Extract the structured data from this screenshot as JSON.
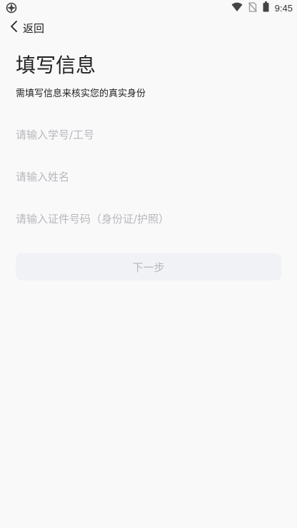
{
  "status_bar": {
    "time": "9:45",
    "left_icon": "app-notification-icon",
    "icons": [
      "wifi-icon",
      "no-sim-icon",
      "battery-icon"
    ]
  },
  "nav": {
    "back_label": "返回",
    "back_icon": "chevron-left-icon"
  },
  "page": {
    "title": "填写信息",
    "subtitle": "需填写信息来核实您的真实身份"
  },
  "form": {
    "fields": [
      {
        "placeholder": "请输入学号/工号",
        "value": ""
      },
      {
        "placeholder": "请输入姓名",
        "value": ""
      },
      {
        "placeholder": "请输入证件号码（身份证/护照）",
        "value": ""
      }
    ],
    "next_label": "下一步",
    "next_enabled": false
  },
  "colors": {
    "background": "#f9f9fa",
    "text": "#222222",
    "placeholder": "#b7b8bc",
    "button_bg": "#f1f2f5",
    "button_text": "#b4b6bb"
  }
}
